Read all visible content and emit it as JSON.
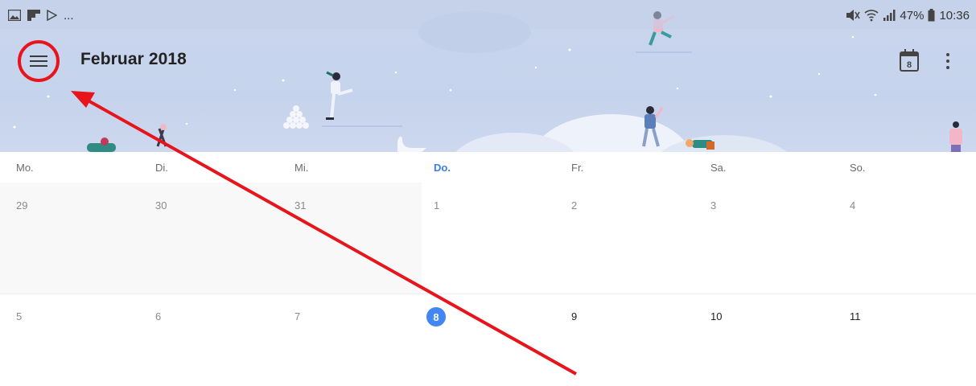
{
  "status_bar": {
    "left_ellipsis": "...",
    "battery_percent": "47%",
    "time": "10:36",
    "icons": [
      "gallery-icon",
      "flipboard-icon",
      "play-store-icon",
      "mute-icon",
      "wifi-icon",
      "signal-icon",
      "battery-icon"
    ]
  },
  "header": {
    "menu_icon": "hamburger-menu-icon",
    "title": "Februar 2018",
    "today_button_date": "8",
    "more_icon": "more-vert-icon"
  },
  "weekdays": [
    "Mo.",
    "Di.",
    "Mi.",
    "Do.",
    "Fr.",
    "Sa.",
    "So."
  ],
  "today_weekday_index": 3,
  "weeks": [
    {
      "days": [
        "29",
        "30",
        "31",
        "1",
        "2",
        "3",
        "4"
      ]
    },
    {
      "days": [
        "5",
        "6",
        "7",
        "8",
        "9",
        "10",
        "11"
      ]
    }
  ],
  "today_day": "8",
  "colors": {
    "accent": "#4285f4",
    "today_label": "#3b7ce6",
    "annotation": "#e8141b",
    "header_bg": "#c9d6ee"
  }
}
